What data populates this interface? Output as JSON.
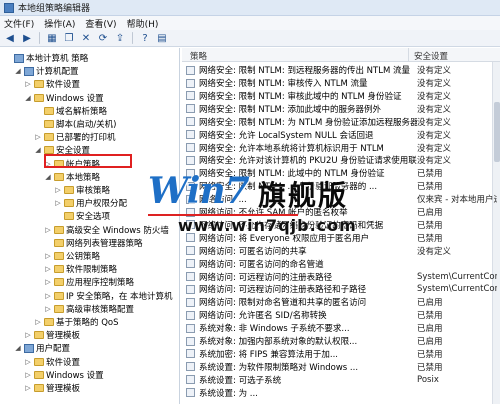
{
  "window": {
    "title": "本地组策略编辑器"
  },
  "menu": [
    "文件(F)",
    "操作(A)",
    "查看(V)",
    "帮助(H)"
  ],
  "toolbar": {
    "icons": [
      "back-arrow-icon",
      "forward-arrow-icon",
      "folder-up-icon",
      "copy-icon",
      "delete-icon",
      "refresh-icon",
      "export-icon",
      "help-icon",
      "view-icon"
    ]
  },
  "tree": [
    {
      "label": "本地计算机 策略",
      "indent": 0,
      "exp": "",
      "icon": "computer-icon"
    },
    {
      "label": "计算机配置",
      "indent": 1,
      "exp": "◢",
      "icon": "computer-icon"
    },
    {
      "label": "软件设置",
      "indent": 2,
      "exp": "▷",
      "icon": "folder-icon"
    },
    {
      "label": "Windows 设置",
      "indent": 2,
      "exp": "◢",
      "icon": "folder-icon"
    },
    {
      "label": "域名解析策略",
      "indent": 3,
      "exp": "",
      "icon": "folder-icon"
    },
    {
      "label": "脚本(启动/关机)",
      "indent": 3,
      "exp": "",
      "icon": "folder-icon"
    },
    {
      "label": "已部署的打印机",
      "indent": 3,
      "exp": "▷",
      "icon": "folder-icon"
    },
    {
      "label": "安全设置",
      "indent": 3,
      "exp": "◢",
      "icon": "folder-icon"
    },
    {
      "label": "帐户策略",
      "indent": 4,
      "exp": "▷",
      "icon": "folder-icon"
    },
    {
      "label": "本地策略",
      "indent": 4,
      "exp": "◢",
      "icon": "folder-icon"
    },
    {
      "label": "审核策略",
      "indent": 5,
      "exp": "▷",
      "icon": "folder-icon"
    },
    {
      "label": "用户权限分配",
      "indent": 5,
      "exp": "▷",
      "icon": "folder-icon"
    },
    {
      "label": "安全选项",
      "indent": 5,
      "exp": "",
      "icon": "folder-icon"
    },
    {
      "label": "高级安全 Windows 防火墙",
      "indent": 4,
      "exp": "▷",
      "icon": "folder-icon"
    },
    {
      "label": "网络列表管理器策略",
      "indent": 4,
      "exp": "",
      "icon": "folder-icon"
    },
    {
      "label": "公钥策略",
      "indent": 4,
      "exp": "▷",
      "icon": "folder-icon"
    },
    {
      "label": "软件限制策略",
      "indent": 4,
      "exp": "▷",
      "icon": "folder-icon"
    },
    {
      "label": "应用程序控制策略",
      "indent": 4,
      "exp": "▷",
      "icon": "folder-icon"
    },
    {
      "label": "IP 安全策略，在 本地计算机",
      "indent": 4,
      "exp": "▷",
      "icon": "folder-icon"
    },
    {
      "label": "高级审核策略配置",
      "indent": 4,
      "exp": "▷",
      "icon": "folder-icon"
    },
    {
      "label": "基于策略的 QoS",
      "indent": 3,
      "exp": "▷",
      "icon": "folder-icon"
    },
    {
      "label": "管理模板",
      "indent": 2,
      "exp": "▷",
      "icon": "folder-icon"
    },
    {
      "label": "用户配置",
      "indent": 1,
      "exp": "◢",
      "icon": "computer-icon"
    },
    {
      "label": "软件设置",
      "indent": 2,
      "exp": "▷",
      "icon": "folder-icon"
    },
    {
      "label": "Windows 设置",
      "indent": 2,
      "exp": "▷",
      "icon": "folder-icon"
    },
    {
      "label": "管理模板",
      "indent": 2,
      "exp": "▷",
      "icon": "folder-icon"
    }
  ],
  "columns": {
    "policy": "策略",
    "setting": "安全设置"
  },
  "rows": [
    {
      "name": "网络安全: 限制 NTLM: 到远程服务器的传出 NTLM 流量",
      "value": "没有定义"
    },
    {
      "name": "网络安全: 限制 NTLM: 审核传入 NTLM 流量",
      "value": "没有定义"
    },
    {
      "name": "网络安全: 限制 NTLM: 审核此域中的 NTLM 身份验证",
      "value": "没有定义"
    },
    {
      "name": "网络安全: 限制 NTLM: 添加此域中的服务器例外",
      "value": "没有定义"
    },
    {
      "name": "网络安全: 限制 NTLM: 为 NTLM 身份验证添加远程服务器例外",
      "value": "没有定义"
    },
    {
      "name": "网络安全: 允许 LocalSystem NULL 会话回退",
      "value": "没有定义"
    },
    {
      "name": "网络安全: 允许本地系统将计算机标识用于 NTLM",
      "value": "没有定义"
    },
    {
      "name": "网络安全: 允许对该计算机的 PKU2U 身份验证请求使用联...",
      "value": "没有定义"
    },
    {
      "name": "网络安全: 限制 NTLM: 此域中的 NTLM 身份验证",
      "value": "已禁用"
    },
    {
      "name": "网络安全: 限制 NTLM: ... 身份验证服务器的 ...",
      "value": "已禁用"
    },
    {
      "name": "网络访问: ...",
      "value": "仅来宾 - 对本地用户进..."
    },
    {
      "name": "网络访问: 不允许 SAM 帐户的匿名枚举",
      "value": "已启用"
    },
    {
      "name": "网络访问: 不允许存储网络身份验证的密码和凭据",
      "value": "已禁用"
    },
    {
      "name": "网络访问: 将 Everyone 权限应用于匿名用户",
      "value": "已禁用"
    },
    {
      "name": "网络访问: 可匿名访问的共享",
      "value": "没有定义"
    },
    {
      "name": "网络访问: 可匿名访问的命名管道",
      "value": ""
    },
    {
      "name": "网络访问: 可远程访问的注册表路径",
      "value": "System\\CurrentContro..."
    },
    {
      "name": "网络访问: 可远程访问的注册表路径和子路径",
      "value": "System\\CurrentContro..."
    },
    {
      "name": "网络访问: 限制对命名管道和共享的匿名访问",
      "value": "已启用"
    },
    {
      "name": "网络访问: 允许匿名 SID/名称转换",
      "value": "已禁用"
    },
    {
      "name": "系统对象: 非 Windows 子系统不要求...",
      "value": "已启用"
    },
    {
      "name": "系统对象: 加强内部系统对象的默认权限...",
      "value": "已启用"
    },
    {
      "name": "系统加密: 将 FIPS 兼容算法用于加...",
      "value": "已禁用"
    },
    {
      "name": "系统设置: 为软件限制策略对 Windows ...",
      "value": "已禁用"
    },
    {
      "name": "系统设置: 可选子系统",
      "value": "Posix"
    },
    {
      "name": "系统设置: 为 ...",
      "value": ""
    }
  ],
  "watermark": {
    "logo": "Win7",
    "cn": "旗舰版",
    "url": "www.win7qjb.com"
  }
}
